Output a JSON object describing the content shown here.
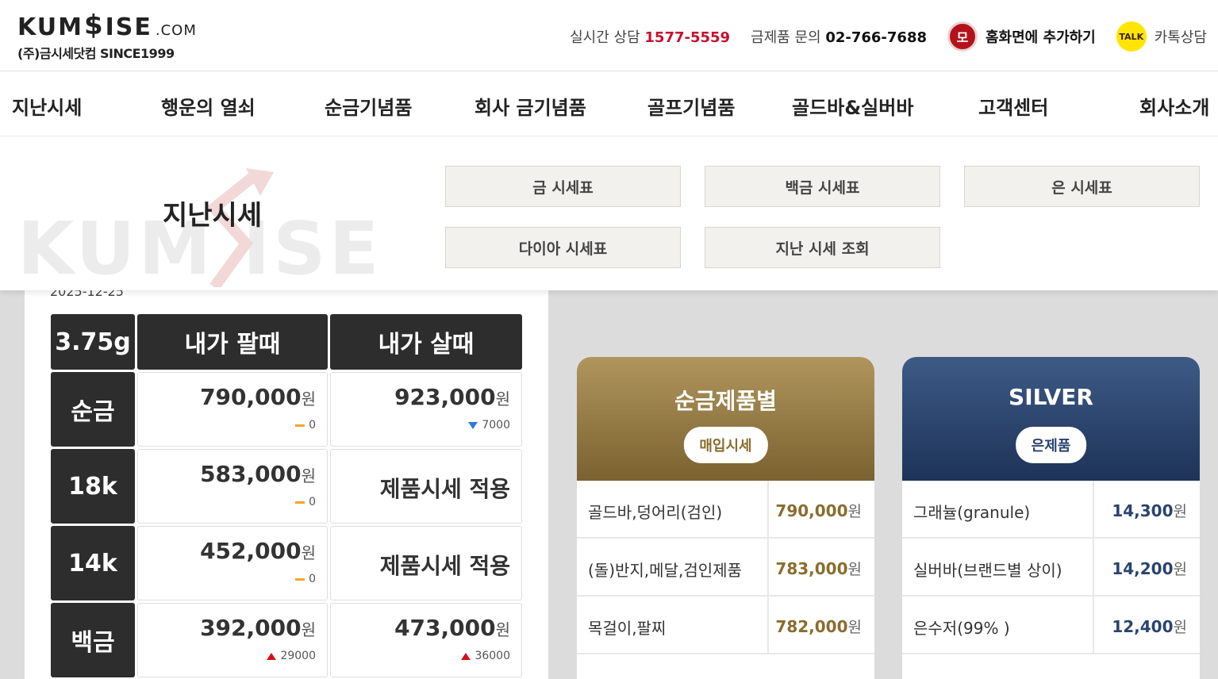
{
  "header": {
    "logo_main": "KUM",
    "logo_s": "$",
    "logo_ise": "ISE",
    "logo_dotcom": ".COM",
    "logo_sub": "(주)금시세닷컴 SINCE1999",
    "realtime_label": "실시간 상담",
    "realtime_number": "1577-5559",
    "inquiry_label": "금제품 문의",
    "inquiry_number": "02-766-7688",
    "home_icon_text": "모",
    "home_label": "홈화면에 추가하기",
    "kakao_icon_text": "TALK",
    "kakao_label": "카톡상담"
  },
  "nav": [
    "지난시세",
    "행운의 열쇠",
    "순금기념품",
    "회사 금기념품",
    "골프기념품",
    "골드바&실버바",
    "고객센터",
    "회사소개"
  ],
  "dropdown": {
    "title": "지난시세",
    "watermark": "KUM   ISE",
    "buttons": [
      "금 시세표",
      "백금 시세표",
      "은 시세표",
      "다이아 시세표",
      "지난 시세 조회"
    ]
  },
  "price_table": {
    "date": "2025-12-25",
    "headers": [
      "3.75g",
      "내가 팔때",
      "내가 살때"
    ],
    "won": "원",
    "rows": [
      {
        "label": "순금",
        "sell": "790,000",
        "sell_delta": "0",
        "sell_dir": "flat",
        "buy": "923,000",
        "buy_delta": "7000",
        "buy_dir": "down"
      },
      {
        "label": "18k",
        "sell": "583,000",
        "sell_delta": "0",
        "sell_dir": "flat",
        "buy_text": "제품시세 적용"
      },
      {
        "label": "14k",
        "sell": "452,000",
        "sell_delta": "0",
        "sell_dir": "flat",
        "buy_text": "제품시세 적용"
      },
      {
        "label": "백금",
        "sell": "392,000",
        "sell_delta": "29000",
        "sell_dir": "up",
        "buy": "473,000",
        "buy_delta": "36000",
        "buy_dir": "up"
      }
    ]
  },
  "gold_card": {
    "title": "순금제품별",
    "pill": "매입시세",
    "color_top": "#b0955c",
    "color_bottom": "#7a6230",
    "accent": "#8a6d2e",
    "items": [
      {
        "label": "골드바,덩어리(검인)",
        "value": "790,000"
      },
      {
        "label": "(돌)반지,메달,검인제품",
        "value": "783,000"
      },
      {
        "label": "목걸이,팔찌",
        "value": "782,000"
      }
    ]
  },
  "silver_card": {
    "title": "SILVER",
    "pill": "은제품",
    "color_top": "#3d5a86",
    "color_bottom": "#1e3358",
    "accent": "#2a4470",
    "items": [
      {
        "label": "그래뉼(granule)",
        "value": "14,300"
      },
      {
        "label": "실버바(브랜드별 상이)",
        "value": "14,200"
      },
      {
        "label": "은수저(99% )",
        "value": "12,400"
      }
    ]
  }
}
